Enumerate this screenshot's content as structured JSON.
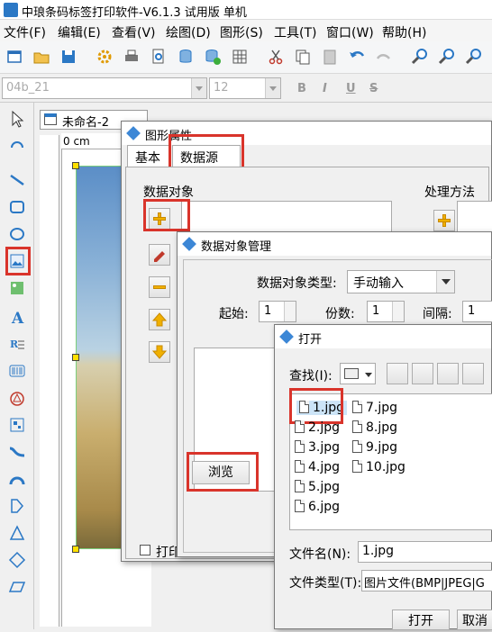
{
  "app": {
    "title": "中琅条码标签打印软件-V6.1.3 试用版 单机"
  },
  "menu": {
    "items": [
      "文件(F)",
      "编辑(E)",
      "查看(V)",
      "绘图(D)",
      "图形(S)",
      "工具(T)",
      "窗口(W)",
      "帮助(H)"
    ]
  },
  "fontbar": {
    "font_name": "04b_21",
    "font_size": "12",
    "bold": "B",
    "italic": "I",
    "underline": "U",
    "strike": "S"
  },
  "document": {
    "tab_title": "未命名-2",
    "ruler_label": "0 cm"
  },
  "props_dialog": {
    "title": "图形属性",
    "tabs": [
      "基本",
      "数据源"
    ],
    "data_object_label": "数据对象",
    "process_label": "处理方法",
    "print_checkbox": "打印"
  },
  "dom_dialog": {
    "title": "数据对象管理",
    "type_label": "数据对象类型:",
    "type_value": "手动输入",
    "start_label": "起始:",
    "start_value": "1",
    "copies_label": "份数:",
    "copies_value": "1",
    "interval_label": "间隔:",
    "interval_value": "1",
    "browse_button": "浏览"
  },
  "open_dialog": {
    "title": "打开",
    "lookin_label": "查找(I):",
    "files": [
      "1.jpg",
      "2.jpg",
      "3.jpg",
      "4.jpg",
      "5.jpg",
      "6.jpg",
      "7.jpg",
      "8.jpg",
      "9.jpg",
      "10.jpg"
    ],
    "filename_label": "文件名(N):",
    "filename_value": "1.jpg",
    "filetype_label": "文件类型(T):",
    "filetype_value": "图片文件(BMP|JPEG|G",
    "open_button": "打开",
    "cancel_button": "取消"
  },
  "colors": {
    "highlight": "#d9342b",
    "selection_handle": "#ffe000"
  }
}
